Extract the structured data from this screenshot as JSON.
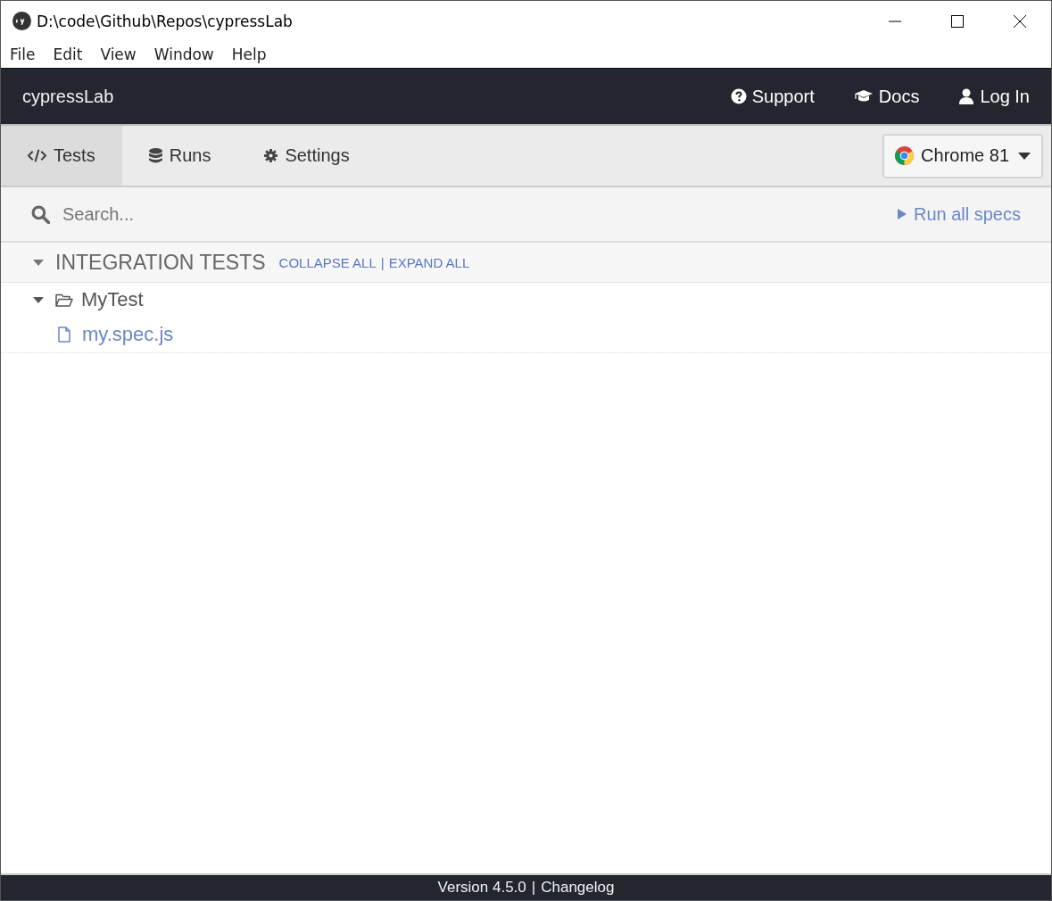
{
  "window": {
    "title": "D:\\code\\Github\\Repos\\cypressLab"
  },
  "menu": [
    "File",
    "Edit",
    "View",
    "Window",
    "Help"
  ],
  "header": {
    "project": "cypressLab",
    "links": [
      {
        "label": "Support",
        "kind": "help"
      },
      {
        "label": "Docs",
        "kind": "docs"
      },
      {
        "label": "Log In",
        "kind": "user"
      }
    ]
  },
  "tabs": [
    {
      "label": "Tests",
      "kind": "code",
      "selected": true
    },
    {
      "label": "Runs",
      "kind": "database",
      "selected": false
    },
    {
      "label": "Settings",
      "kind": "gear",
      "selected": false
    }
  ],
  "browser": {
    "label": "Chrome 81"
  },
  "search": {
    "placeholder": "Search..."
  },
  "run_all": "Run all specs",
  "section": {
    "title": "INTEGRATION TESTS",
    "expanded": true,
    "collapse": "COLLAPSE ALL",
    "separator": "|",
    "expand": "EXPAND ALL"
  },
  "tree": [
    {
      "name": "MyTest",
      "kind": "folder",
      "expanded": true,
      "children": [
        {
          "name": "my.spec.js",
          "kind": "file"
        }
      ]
    }
  ],
  "footer": {
    "version": "Version 4.5.0",
    "separator": "|",
    "changelog": "Changelog"
  }
}
